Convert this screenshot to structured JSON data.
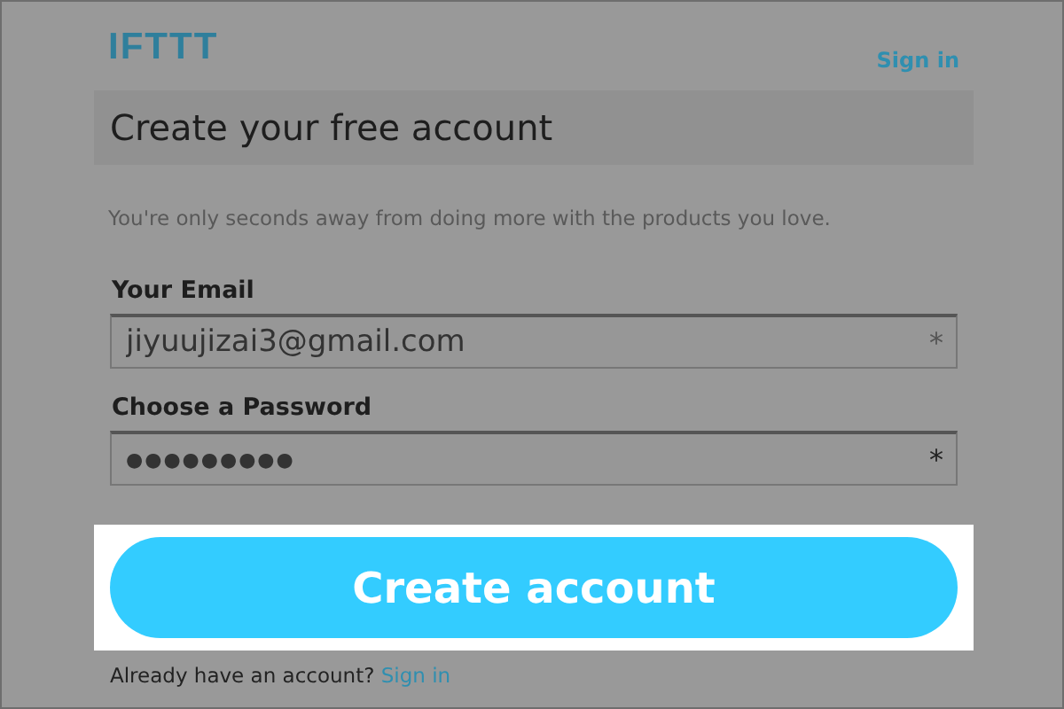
{
  "header": {
    "logo": "IFTTT",
    "sign_in": "Sign in"
  },
  "title": "Create your free account",
  "subtitle": "You're only seconds away from doing more with the products you love.",
  "fields": [
    {
      "label": "Your Email",
      "value": "jiyuujizai3@gmail.com",
      "required_mark": "*"
    },
    {
      "label": "Choose a Password",
      "value": "●●●●●●●●●",
      "required_mark": "*"
    }
  ],
  "submit": {
    "label": "Create account",
    "highlighted": true
  },
  "footer": {
    "text": "Already have an account?",
    "link": "Sign in"
  }
}
